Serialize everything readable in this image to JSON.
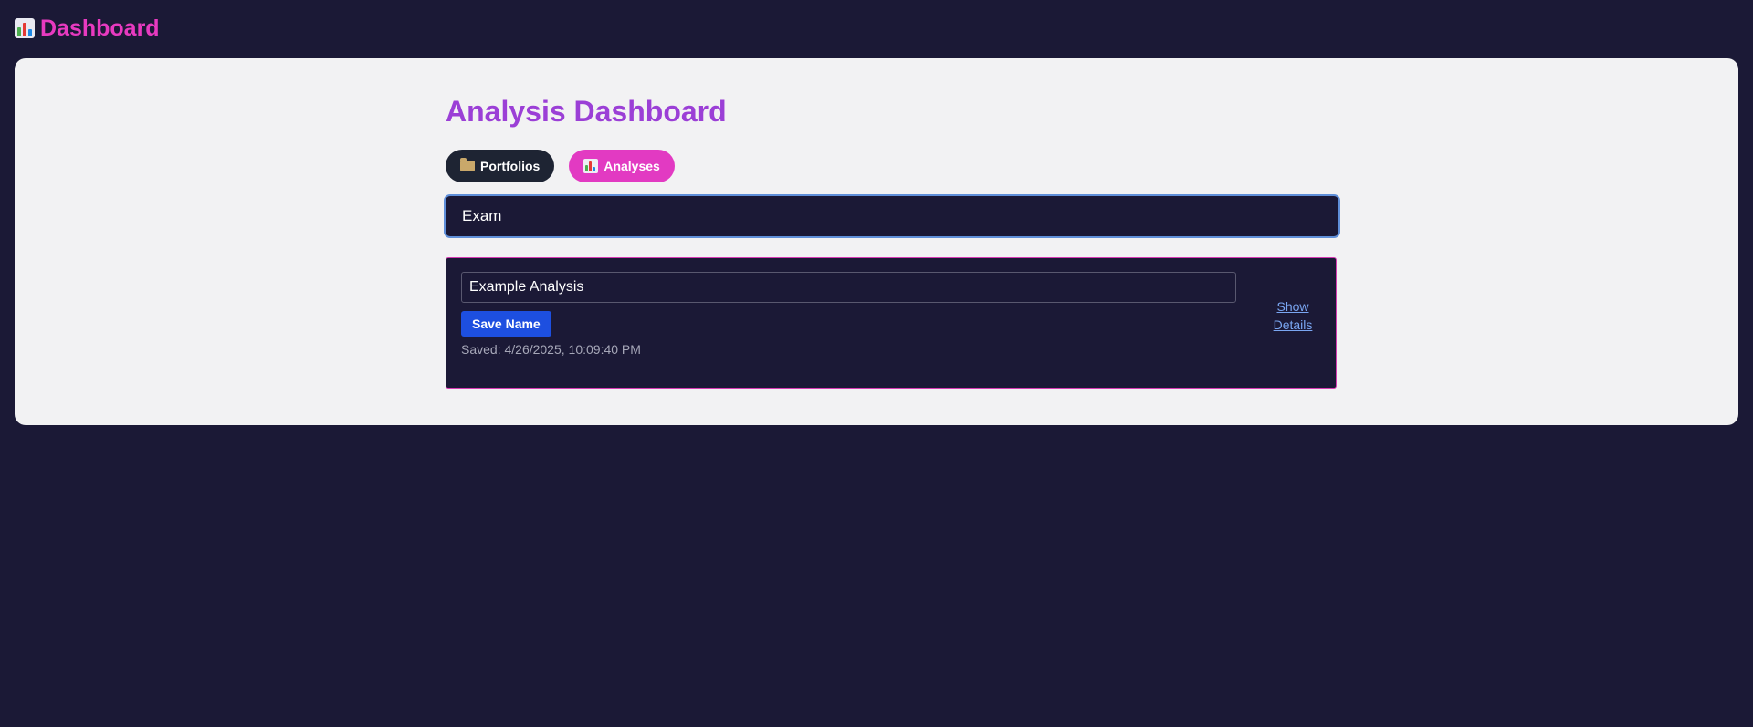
{
  "app": {
    "title": "Dashboard",
    "icon": "bar-chart-icon"
  },
  "page": {
    "title": "Analysis Dashboard"
  },
  "tabs": [
    {
      "label": "Portfolios",
      "icon": "folder-icon",
      "active": false
    },
    {
      "label": "Analyses",
      "icon": "bar-chart-icon",
      "active": true
    }
  ],
  "search": {
    "value": "Exam",
    "placeholder": ""
  },
  "analyses": [
    {
      "name": "Example Analysis",
      "save_label": "Save Name",
      "saved_text": "Saved: 4/26/2025, 10:09:40 PM",
      "details_label": "Show Details"
    }
  ],
  "colors": {
    "background": "#1b1936",
    "accent_pink": "#e23ac2",
    "title_purple": "#9b3fd6",
    "button_blue": "#1d4fe0",
    "link_blue": "#7aa6f2",
    "panel": "#f2f2f3"
  }
}
